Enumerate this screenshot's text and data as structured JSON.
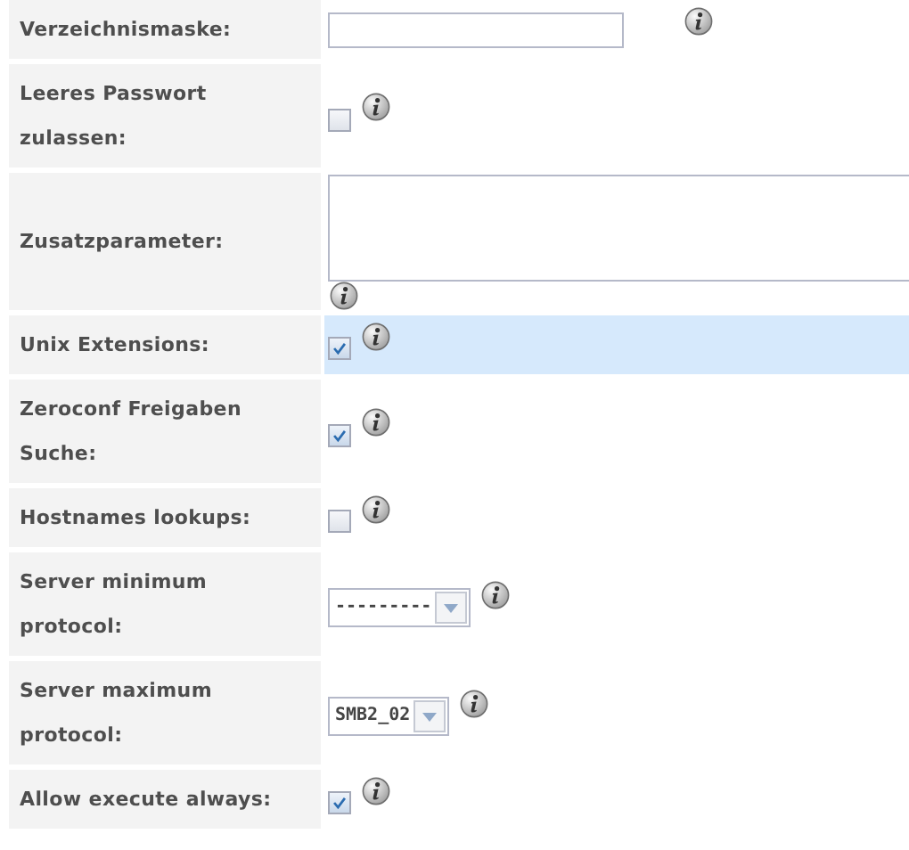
{
  "rows": [
    {
      "label": "Verzeichnismaske:",
      "kind": "text",
      "value": "",
      "selected": false
    },
    {
      "label": "Leeres Passwort zulassen:",
      "kind": "checkbox",
      "checked": false,
      "selected": false
    },
    {
      "label": "Zusatzparameter:",
      "kind": "textarea",
      "value": "",
      "selected": false
    },
    {
      "label": "Unix Extensions:",
      "kind": "checkbox",
      "checked": true,
      "selected": true
    },
    {
      "label": "Zeroconf Freigaben Suche:",
      "kind": "checkbox",
      "checked": true,
      "selected": false
    },
    {
      "label": "Hostnames lookups:",
      "kind": "checkbox",
      "checked": false,
      "selected": false
    },
    {
      "label": "Server minimum protocol:",
      "kind": "select",
      "value": "---------",
      "selected": false
    },
    {
      "label": "Server maximum protocol:",
      "kind": "select",
      "value": "SMB2_02",
      "selected": false
    },
    {
      "label": "Allow execute always:",
      "kind": "checkbox",
      "checked": true,
      "selected": false
    }
  ]
}
